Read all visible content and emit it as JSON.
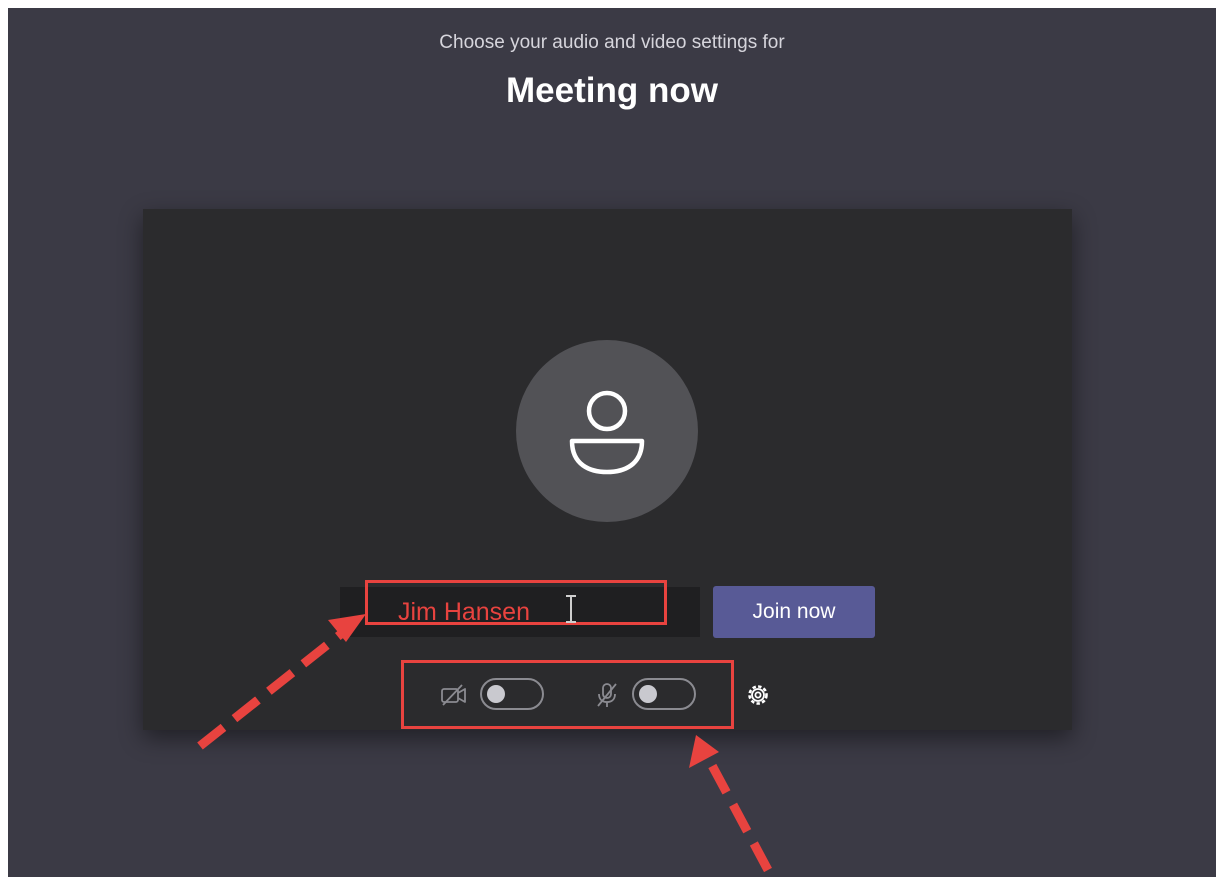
{
  "header": {
    "subtitle": "Choose your audio and video settings for",
    "title": "Meeting now"
  },
  "preview": {
    "avatar_icon": "person-icon"
  },
  "name_input": {
    "value": "Jim Hansen"
  },
  "join_button": {
    "label": "Join now"
  },
  "controls": {
    "camera": {
      "icon": "camera-off-icon",
      "enabled": false
    },
    "microphone": {
      "icon": "mic-off-icon",
      "enabled": false
    },
    "settings": {
      "icon": "gear-icon"
    }
  },
  "colors": {
    "background": "#3b3a45",
    "preview_background": "#2b2b2d",
    "join_button": "#585a96",
    "annotation_red": "#e8433f"
  }
}
